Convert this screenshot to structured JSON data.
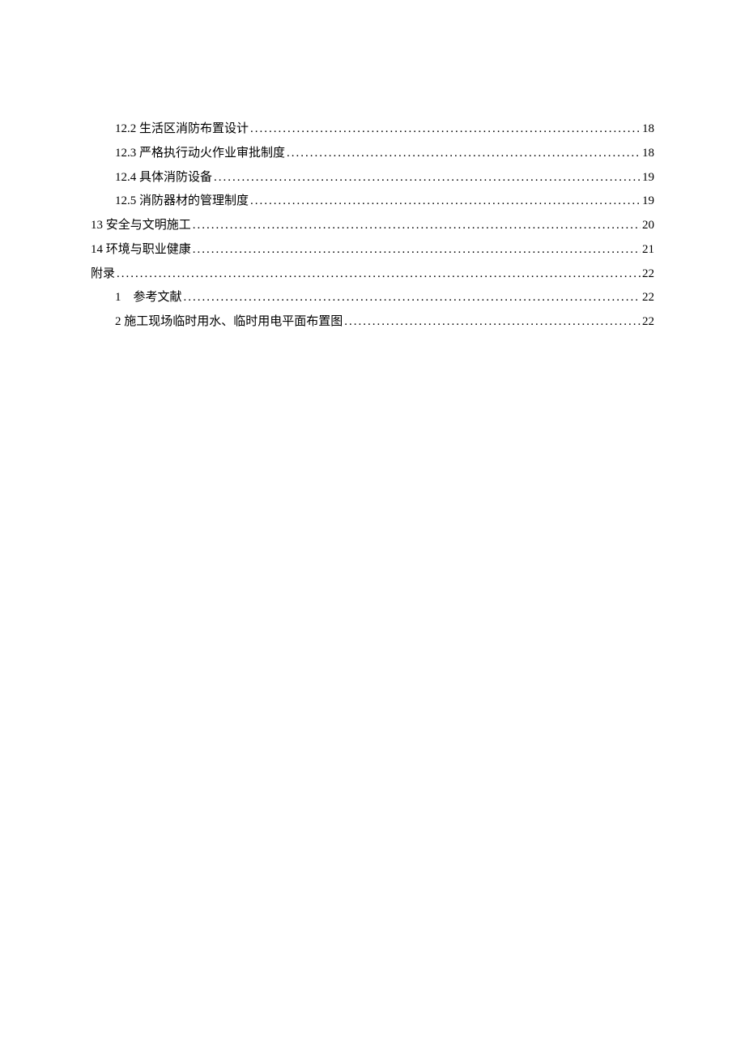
{
  "toc": [
    {
      "level": 2,
      "label": "12.2 生活区消防布置设计",
      "page": "18"
    },
    {
      "level": 2,
      "label": "12.3 严格执行动火作业审批制度",
      "page": "18"
    },
    {
      "level": 2,
      "label": "12.4 具体消防设备",
      "page": "19"
    },
    {
      "level": 2,
      "label": "12.5 消防器材的管理制度",
      "page": "19"
    },
    {
      "level": 1,
      "label": "13 安全与文明施工",
      "page": "20"
    },
    {
      "level": 1,
      "label": "14 环境与职业健康",
      "page": "21"
    },
    {
      "level": 1,
      "label": "附录",
      "page": "22"
    },
    {
      "level": 2,
      "label": "1　参考文献",
      "page": "22"
    },
    {
      "level": 2,
      "label": "2 施工现场临时用水、临时用电平面布置图",
      "page": "22"
    }
  ]
}
